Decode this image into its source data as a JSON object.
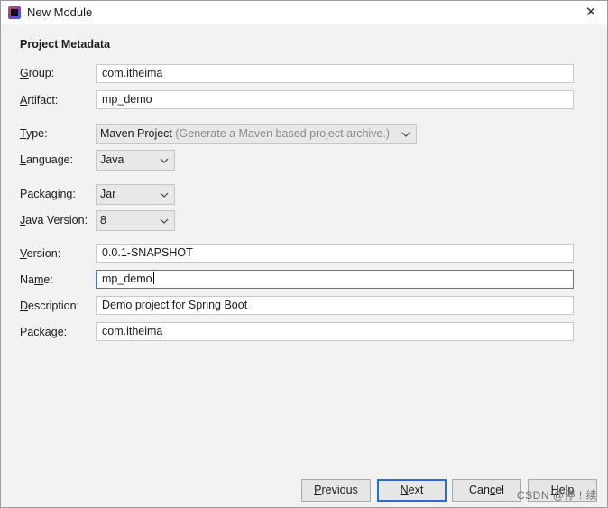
{
  "window": {
    "title": "New Module",
    "close_glyph": "✕"
  },
  "section": {
    "title": "Project Metadata"
  },
  "fields": {
    "group": {
      "label_mn": "G",
      "label_rest": "roup:",
      "value": "com.itheima"
    },
    "artifact": {
      "label_mn": "A",
      "label_rest": "rtifact:",
      "value": "mp_demo"
    },
    "type": {
      "label_mn": "T",
      "label_rest": "ype:",
      "value": "Maven Project",
      "hint": "(Generate a Maven based project archive.)"
    },
    "language": {
      "label_mn": "L",
      "label_rest": "anguage:",
      "value": "Java"
    },
    "packaging": {
      "label_pre": "Packa",
      "label_mn": "g",
      "label_rest": "ing:",
      "value": "Jar"
    },
    "java_version": {
      "label_mn": "J",
      "label_rest": "ava Version:",
      "value": "8"
    },
    "version": {
      "label_mn": "V",
      "label_rest": "ersion:",
      "value": "0.0.1-SNAPSHOT"
    },
    "name": {
      "label_pre": "Na",
      "label_mn": "m",
      "label_rest": "e:",
      "value": "mp_demo"
    },
    "description": {
      "label_mn": "D",
      "label_rest": "escription:",
      "value": "Demo project for Spring Boot"
    },
    "package": {
      "label_pre": "Pac",
      "label_mn": "k",
      "label_rest": "age:",
      "value": "com.itheima"
    }
  },
  "buttons": {
    "previous": {
      "mn": "P",
      "rest": "revious"
    },
    "next": {
      "mn": "N",
      "rest": "ext"
    },
    "cancel": {
      "pre": "Can",
      "mn": "c",
      "rest": "el"
    },
    "help": {
      "mn": "H",
      "rest": "elp"
    }
  },
  "watermark": "CSDN @停 ! 续",
  "icons": {
    "app": "intellij-idea-icon",
    "close": "close-icon",
    "dropdown": "chevron-down-icon"
  },
  "colors": {
    "focus_border": "#3d7bd6",
    "default_button_border": "#2c6ad6",
    "hint_text": "#8a8a8a"
  }
}
